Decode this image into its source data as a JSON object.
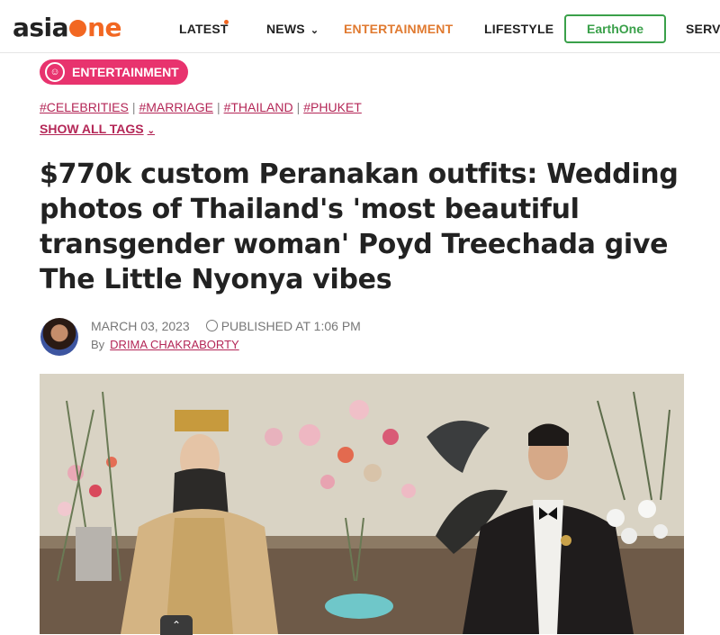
{
  "brand": {
    "logo_prefix": "asia",
    "logo_suffix": "ne"
  },
  "nav": {
    "latest": "LATEST",
    "news": "NEWS",
    "entertainment": "ENTERTAINMENT",
    "lifestyle": "LIFESTYLE",
    "earthone": "EarthOne",
    "services": "SERVI"
  },
  "category": {
    "label": "ENTERTAINMENT"
  },
  "tags": [
    "#CELEBRITIES",
    "#MARRIAGE",
    "#THAILAND",
    "#PHUKET"
  ],
  "show_all_tags": "SHOW ALL TAGS",
  "headline": "$770k custom Peranakan outfits: Wedding photos of Thailand's 'most beautiful transgender woman' Poyd Treechada give The Little Nyonya vibes",
  "meta": {
    "date": "MARCH 03, 2023",
    "published": "PUBLISHED AT 1:06 PM",
    "by": "By",
    "author": "DRIMA CHAKRABORTY"
  },
  "colors": {
    "accent": "#f26722",
    "pink": "#e8336e",
    "link": "#b42757",
    "green": "#3aa04a"
  }
}
